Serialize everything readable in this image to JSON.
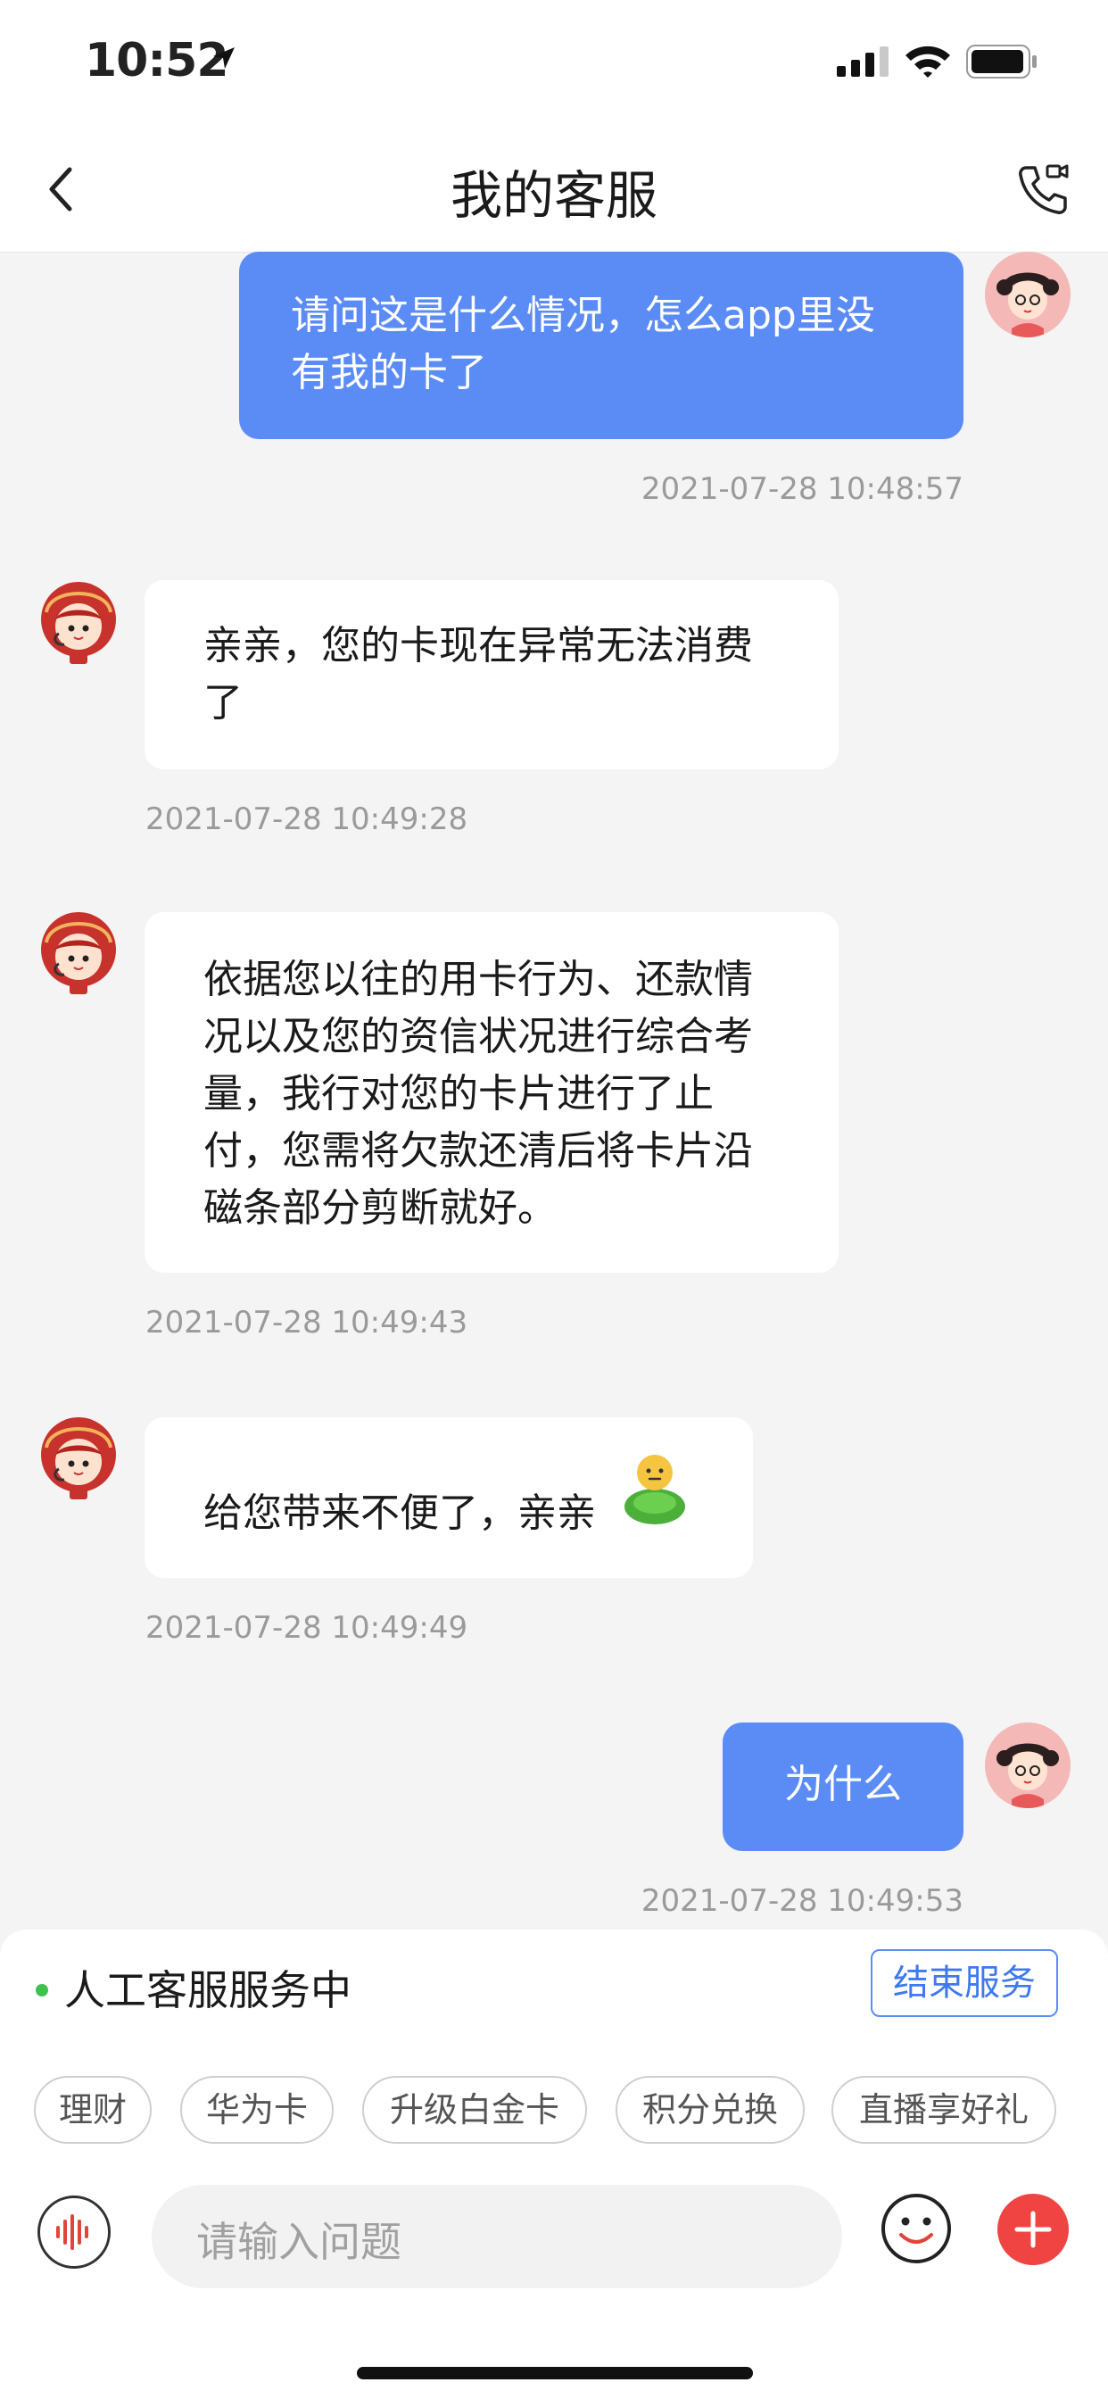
{
  "status_bar": {
    "time": "10:52"
  },
  "header": {
    "title": "我的客服"
  },
  "messages": [
    {
      "side": "me",
      "lines": [
        "请问这是什么情况，怎么app里没",
        "有我的卡了"
      ],
      "time": "2021-07-28 10:48:57"
    },
    {
      "side": "them",
      "lines": [
        "亲亲，您的卡现在异常无法消费",
        "了"
      ],
      "time": "2021-07-28 10:49:28"
    },
    {
      "side": "them",
      "lines": [
        "依据您以往的用卡行为、还款情",
        "况以及您的资信状况进行综合考",
        "量，我行对您的卡片进行了止",
        "付，您需将欠款还清后将卡片沿",
        "磁条部分剪断就好。"
      ],
      "time": "2021-07-28 10:49:43"
    },
    {
      "side": "them",
      "lines": [
        "给您带来不便了，亲亲"
      ],
      "emoji": "sticker-icon",
      "time": "2021-07-28 10:49:49"
    },
    {
      "side": "me",
      "lines": [
        "为什么"
      ],
      "time": "2021-07-28 10:49:53"
    }
  ],
  "service": {
    "status": "人工客服服务中",
    "end_label": "结束服务"
  },
  "quick_actions": [
    "理财",
    "华为卡",
    "升级白金卡",
    "积分兑换",
    "直播享好礼"
  ],
  "input": {
    "placeholder": "请输入问题"
  },
  "colors": {
    "bubble_me": "#5b8cf6",
    "accent_red": "#f04443",
    "status_green": "#3fc150"
  }
}
